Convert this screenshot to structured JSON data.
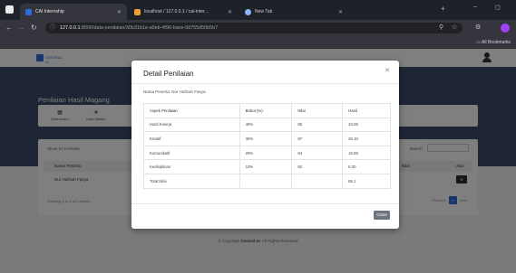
{
  "browser": {
    "tabs": [
      {
        "title": "CAI Internship",
        "icon": "cai-favicon",
        "color": "#2d6cdf"
      },
      {
        "title": "localhost / 127.0.0.1 / cai-inter…",
        "icon": "phpmyadmin-favicon",
        "color": "#f0a030"
      },
      {
        "title": "New Tab",
        "icon": "chrome-favicon",
        "color": "#8ab4f8"
      }
    ],
    "address_host": "127.0.0.1",
    "address_rest": ":8000/data-penilaian/30b31b1e-a0eb-4f96-bace-0d755d50b5b7",
    "bookmarks_label": "All Bookmarks"
  },
  "site": {
    "logo_text": "CENTRAL AI",
    "page_title": "Penilaian Hasil Magang",
    "breadcrumb": "Home  /  Penilaian",
    "menu": [
      {
        "label": "Dashboard",
        "icon": "grid-icon"
      },
      {
        "label": "Data Master",
        "icon": "star-icon"
      }
    ],
    "table": {
      "show_entries": "Show  10  ▾  entries",
      "search_label": "Search:",
      "headers": [
        "Nama Peserta",
        "Nilai",
        "Aksi"
      ],
      "row": {
        "nama": "Nur Hafizah Fasya",
        "aksi": "⊕"
      },
      "showing": "Showing 1 to 1 of 1 entries",
      "pager": {
        "prev": "Previous",
        "current": "1",
        "next": "Next"
      }
    },
    "footer_prefix": "© Copyright ",
    "footer_brand": "Central AI",
    "footer_suffix": ". All Rights Reserved"
  },
  "modal": {
    "title": "Detail Penilaian",
    "peserta_line": "Nama Peserta: Nur Hafizah Fasya",
    "headers": {
      "aspek": "Aspek Penilaian",
      "bobot": "Bobot (%)",
      "nilai": "Nilai",
      "hasil": "Hasil"
    },
    "rows": [
      {
        "aspek": "Hasil Kinerja",
        "bobot": "40%",
        "nilai": "85",
        "hasil": "34.00"
      },
      {
        "aspek": "Kreatif",
        "bobot": "30%",
        "nilai": "87",
        "hasil": "26.10"
      },
      {
        "aspek": "Komunikatif",
        "bobot": "20%",
        "nilai": "84",
        "hasil": "16.80"
      },
      {
        "aspek": "Kedisiplinan",
        "bobot": "10%",
        "nilai": "82",
        "hasil": "8.20"
      }
    ],
    "total": {
      "label": "Total Nilai",
      "value": "85.1"
    },
    "close_label": "Close"
  }
}
